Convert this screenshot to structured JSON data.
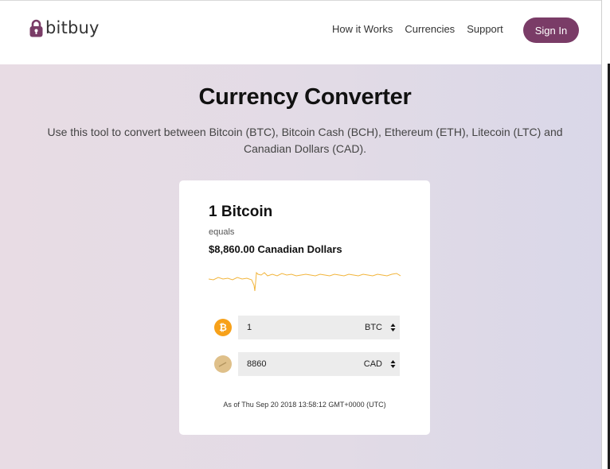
{
  "header": {
    "logo_text": "bitbuy",
    "nav": [
      "How it Works",
      "Currencies",
      "Support"
    ],
    "signin_label": "Sign In"
  },
  "main": {
    "title": "Currency Converter",
    "subtitle": "Use this tool to convert between Bitcoin (BTC), Bitcoin Cash (BCH), Ethereum (ETH), Litecoin (LTC) and Canadian Dollars (CAD)."
  },
  "converter": {
    "amount_title": "1 Bitcoin",
    "equals": "equals",
    "result": "$8,860.00 Canadian Dollars",
    "from": {
      "value": "1",
      "currency": "BTC",
      "icon": "bitcoin-icon"
    },
    "to": {
      "value": "8860",
      "currency": "CAD",
      "icon": "cad-icon"
    },
    "timestamp": "As of Thu Sep 20 2018 13:58:12 GMT+0000 (UTC)"
  },
  "colors": {
    "accent": "#7a3c67",
    "btc": "#f7a11a",
    "cad": "#dfc08a",
    "sparkline": "#f2b53c"
  }
}
